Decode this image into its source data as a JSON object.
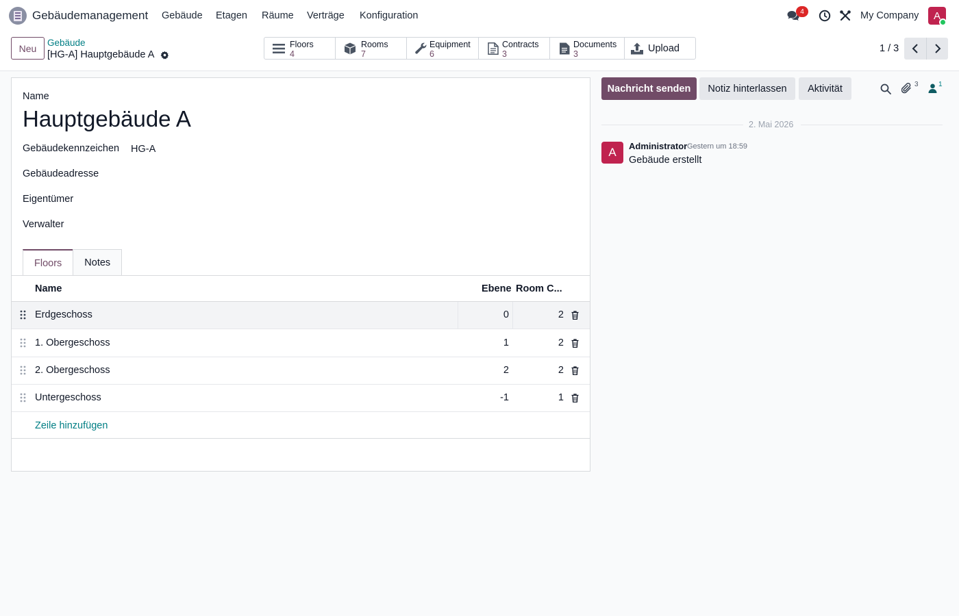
{
  "navbar": {
    "app_name": "Gebäudemanagement",
    "menu": [
      "Gebäude",
      "Etagen",
      "Räume",
      "Verträge",
      "Konfiguration"
    ],
    "chat_badge": "4",
    "company": "My Company",
    "avatar_letter": "A"
  },
  "control": {
    "new_button": "Neu",
    "breadcrumb_parent": "Gebäude",
    "breadcrumb_current": "[HG-A] Hauptgebäude A",
    "stats": [
      {
        "label": "Floors",
        "value": "4",
        "icon": "list-icon"
      },
      {
        "label": "Rooms",
        "value": "7",
        "icon": "cube-icon"
      },
      {
        "label": "Equipment",
        "value": "6",
        "icon": "wrench-icon"
      },
      {
        "label": "Contracts",
        "value": "3",
        "icon": "file-icon"
      },
      {
        "label": "Documents",
        "value": "3",
        "icon": "document-icon"
      }
    ],
    "upload": "Upload",
    "pager": "1 / 3"
  },
  "form": {
    "name_label": "Name",
    "title": "Hauptgebäude A",
    "fields": [
      {
        "label": "Gebäudekennzeichen",
        "value": "HG-A"
      },
      {
        "label": "Gebäudeadresse",
        "value": ""
      },
      {
        "label": "Eigentümer",
        "value": ""
      },
      {
        "label": "Verwalter",
        "value": ""
      }
    ],
    "tabs": [
      "Floors",
      "Notes"
    ],
    "columns": {
      "name": "Name",
      "level": "Ebene",
      "rooms": "Room C..."
    },
    "rows": [
      {
        "name": "Erdgeschoss",
        "level": "0",
        "rooms": "2"
      },
      {
        "name": "1. Obergeschoss",
        "level": "1",
        "rooms": "2"
      },
      {
        "name": "2. Obergeschoss",
        "level": "2",
        "rooms": "2"
      },
      {
        "name": "Untergeschoss",
        "level": "-1",
        "rooms": "1"
      }
    ],
    "add_line": "Zeile hinzufügen"
  },
  "chatter": {
    "send_message": "Nachricht senden",
    "log_note": "Notiz hinterlassen",
    "activity": "Aktivität",
    "attachments_count": "3",
    "followers_count": "1",
    "date": "2. Mai 2026",
    "message": {
      "avatar_letter": "A",
      "author": "Administrator",
      "time": "Gestern um 18:59",
      "body": "Gebäude erstellt"
    }
  },
  "colors": {
    "brand": "#714b67",
    "link": "#017e84",
    "avatar": "#c0234f",
    "badge": "#dc2626"
  }
}
